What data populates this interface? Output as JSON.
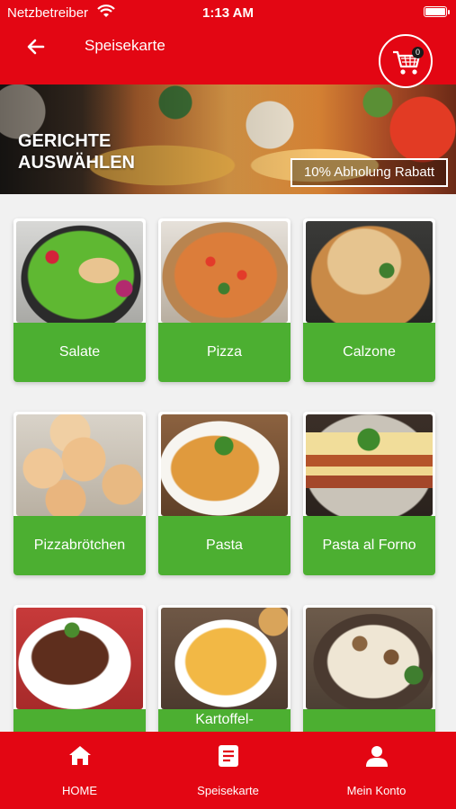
{
  "status_bar": {
    "carrier": "Netzbetreiber",
    "time": "1:13 AM",
    "icons": [
      "wifi-icon",
      "battery-icon"
    ]
  },
  "header": {
    "title": "Speisekarte",
    "back_icon": "arrow-left-icon",
    "cart_icon": "shopping-cart-icon",
    "cart_count": "0"
  },
  "banner": {
    "headline": "GERICHTE AUSWÄHLEN",
    "promo": "10% Abholung Rabatt"
  },
  "categories": [
    {
      "label": "Salate"
    },
    {
      "label": "Pizza"
    },
    {
      "label": "Calzone"
    },
    {
      "label": "Pizzabrötchen"
    },
    {
      "label": "Pasta"
    },
    {
      "label": "Pasta al Forno"
    },
    {
      "label": ""
    },
    {
      "label": "Kartoffel-"
    },
    {
      "label": ""
    }
  ],
  "bottom_nav": {
    "items": [
      {
        "label": "HOME",
        "icon": "home-icon"
      },
      {
        "label": "Speisekarte",
        "icon": "menu-icon"
      },
      {
        "label": "Mein Konto",
        "icon": "user-icon"
      }
    ]
  },
  "colors": {
    "brand_red": "#e30613",
    "category_green": "#4caf31"
  }
}
